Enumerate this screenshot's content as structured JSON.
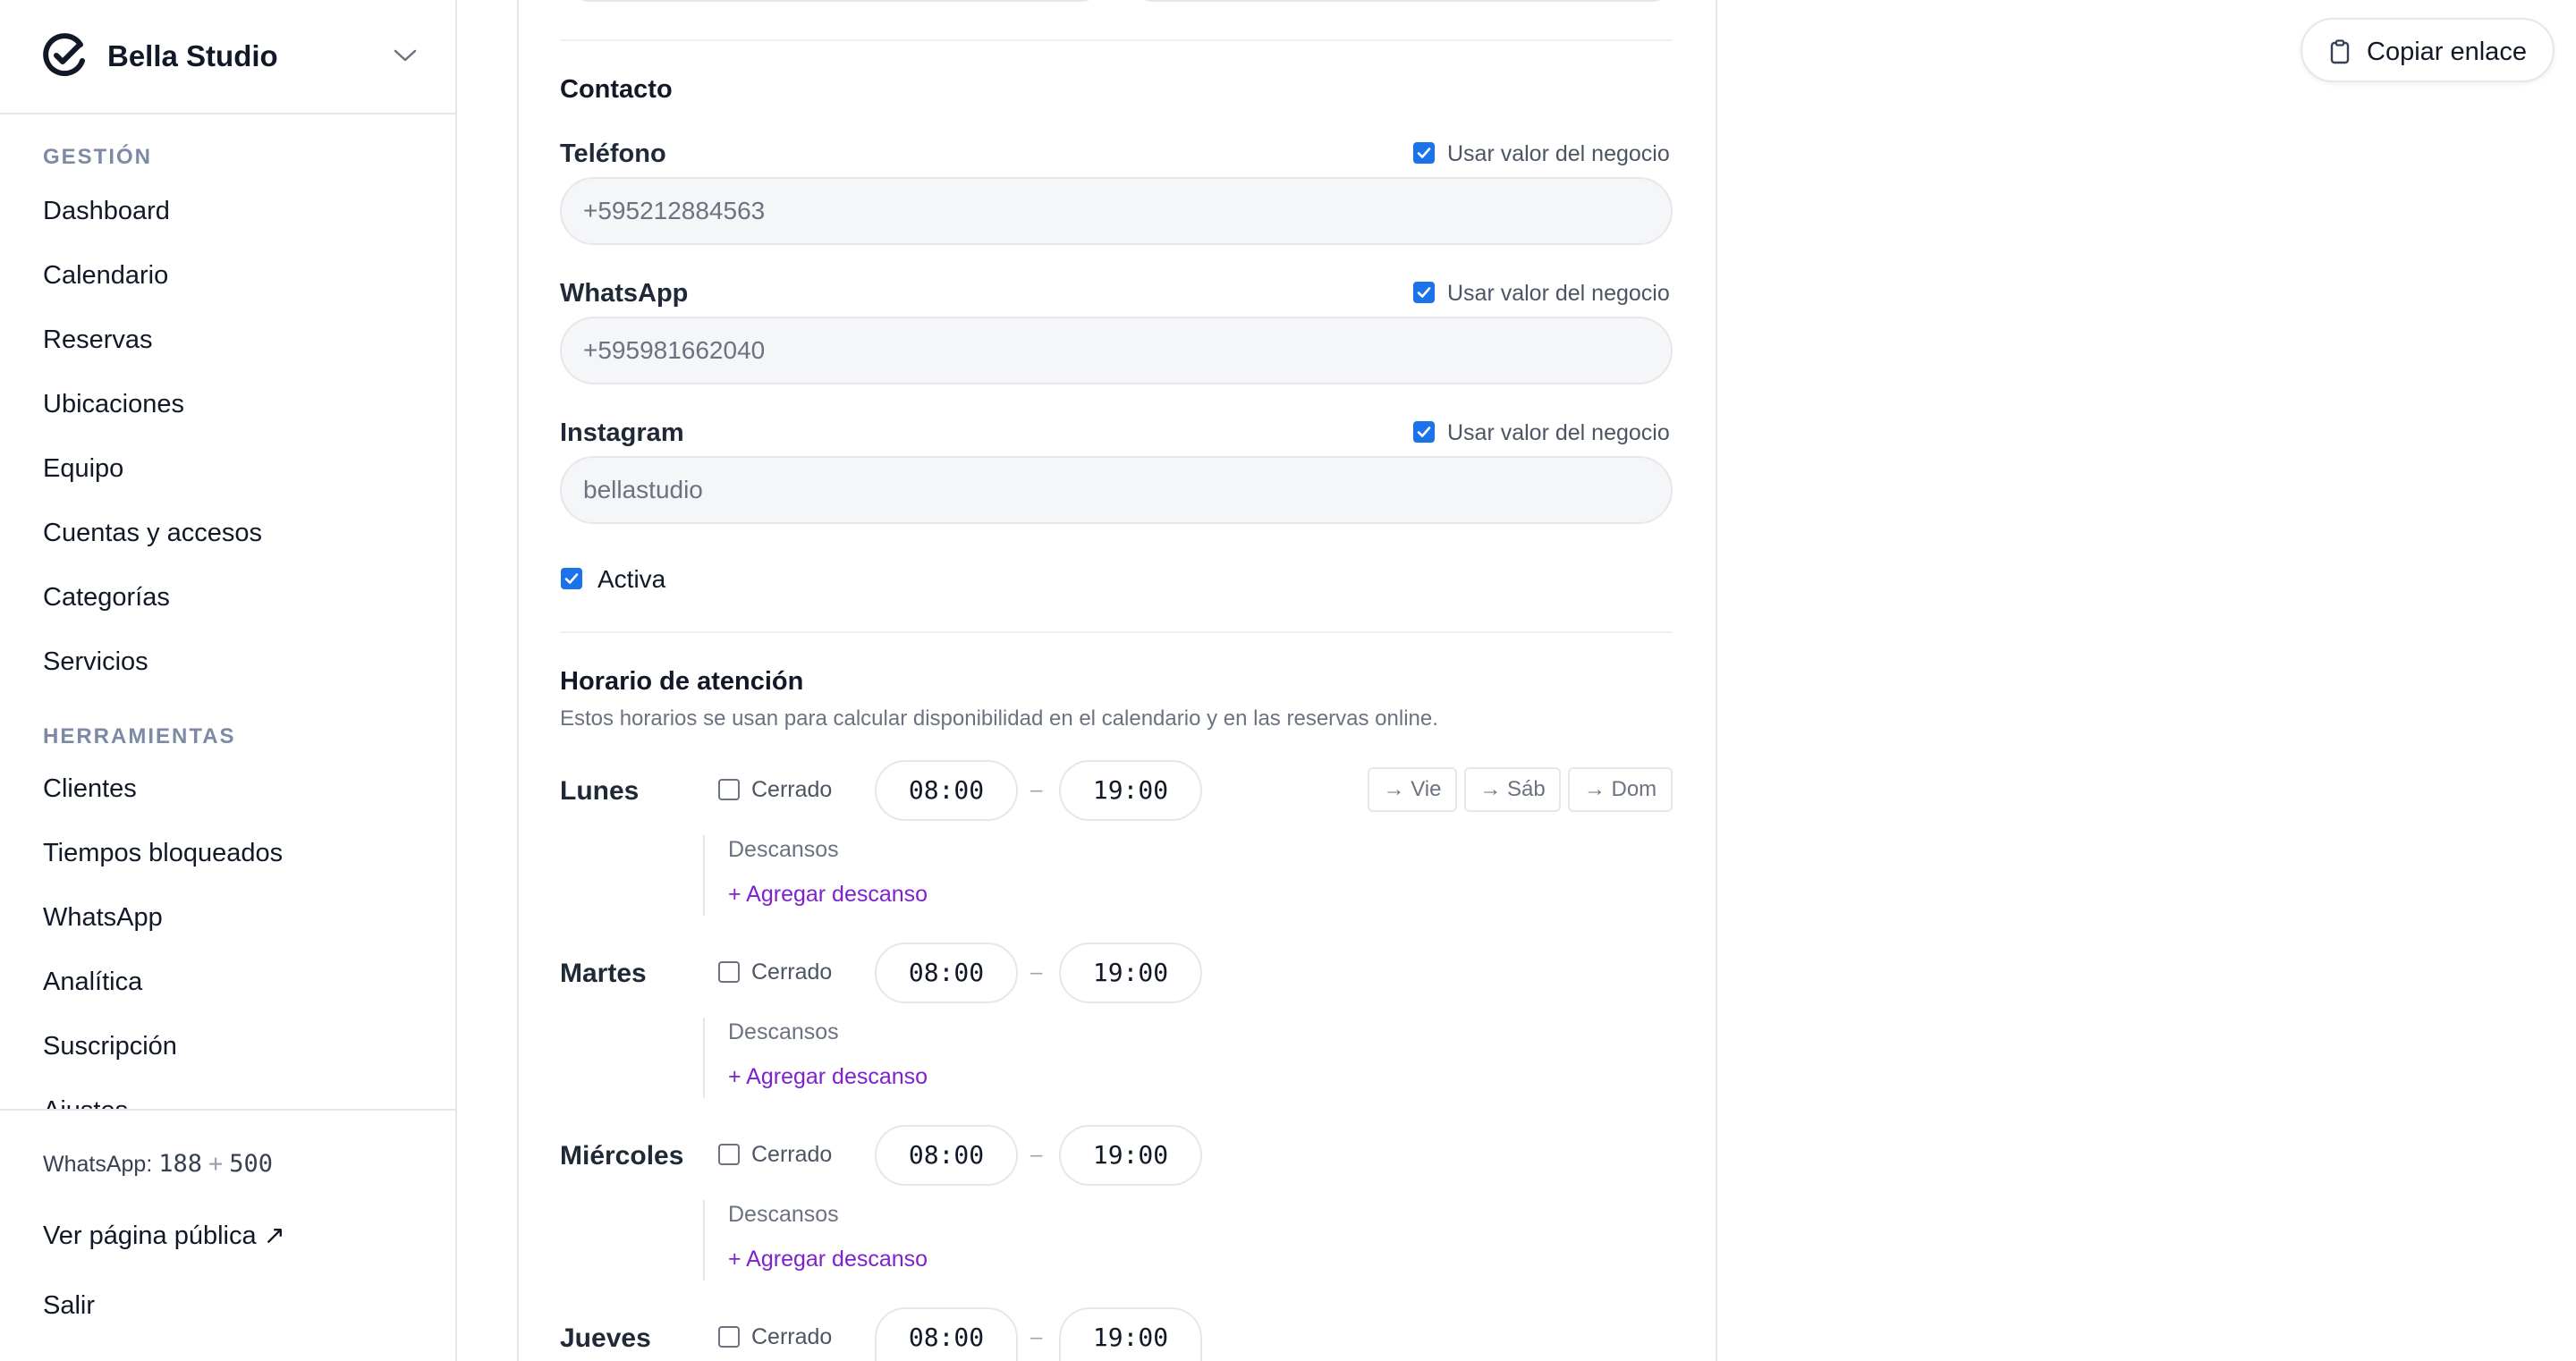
{
  "sidebar": {
    "brand": "Bella Studio",
    "sections": [
      {
        "label": "GESTIÓN",
        "items": [
          "Dashboard",
          "Calendario",
          "Reservas",
          "Ubicaciones",
          "Equipo",
          "Cuentas y accesos",
          "Categorías",
          "Servicios"
        ]
      },
      {
        "label": "HERRAMIENTAS",
        "items": [
          "Clientes",
          "Tiempos bloqueados",
          "WhatsApp",
          "Analítica",
          "Suscripción",
          "Ajustes"
        ]
      }
    ],
    "footer": {
      "whatsapp_label": "WhatsApp:",
      "whatsapp_used": "188",
      "whatsapp_plus": "+",
      "whatsapp_total": "500",
      "public_page": "Ver página pública ↗",
      "logout": "Salir"
    }
  },
  "header": {
    "copy_link": "Copiar enlace"
  },
  "contact": {
    "title": "Contacto",
    "use_business_value": "Usar valor del negocio",
    "phone": {
      "label": "Teléfono",
      "value": "+595212884563"
    },
    "whatsapp": {
      "label": "WhatsApp",
      "value": "+595981662040"
    },
    "instagram": {
      "label": "Instagram",
      "value": "bellastudio"
    },
    "active_label": "Activa"
  },
  "schedule": {
    "title": "Horario de atención",
    "subtitle": "Estos horarios se usan para calcular disponibilidad en el calendario y en las reservas online.",
    "closed_label": "Cerrado",
    "breaks_label": "Descansos",
    "add_break": "+ Agregar descanso",
    "separator": "–",
    "copy_targets": [
      "→ Vie",
      "→ Sáb",
      "→ Dom"
    ],
    "days": [
      {
        "name": "Lunes",
        "open": "08:00",
        "close": "19:00"
      },
      {
        "name": "Martes",
        "open": "08:00",
        "close": "19:00"
      },
      {
        "name": "Miércoles",
        "open": "08:00",
        "close": "19:00"
      },
      {
        "name": "Jueves",
        "open": "08:00",
        "close": "19:00"
      }
    ]
  },
  "colors": {
    "accent": "#1a73e8",
    "link": "#7e22ce",
    "muted": "#6b7280"
  }
}
